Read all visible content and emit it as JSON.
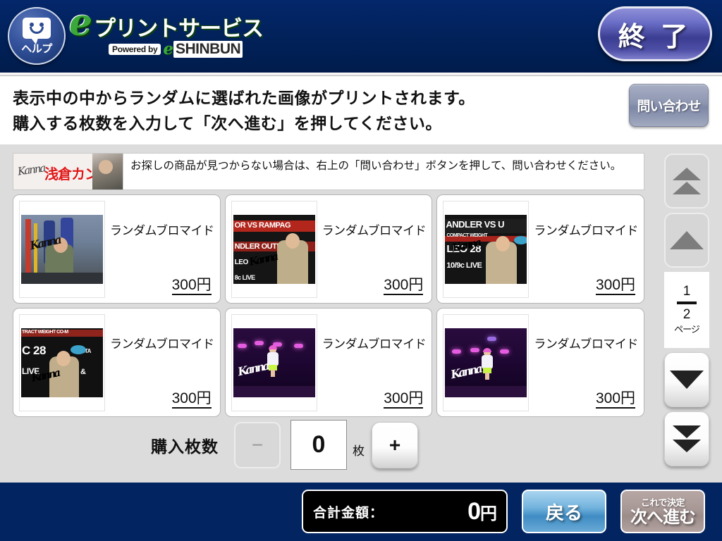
{
  "header": {
    "help_label": "ヘルプ",
    "logo_e": "e",
    "logo_jp": "プリントサービス",
    "powered_by": "Powered by",
    "shinbun_e": "e",
    "shinbun": "SHINBUN",
    "exit_label": "終 了",
    "bg_color": "#012159"
  },
  "instruction": {
    "line1": "表示中の中からランダムに選ばれた画像がプリントされます。",
    "line2": "購入する枚数を入力して「次へ進む」を押してください。",
    "inquiry_label": "問い合わせ"
  },
  "notice": {
    "thumb_signature": "Kanna",
    "thumb_name": "浅倉カンナ",
    "text": "お探しの商品が見つからない場合は、右上の「問い合わせ」ボタンを押して、問い合わせください。"
  },
  "products": [
    {
      "title": "ランダムブロマイド",
      "price": "300円",
      "photo": "gym-punching-bags",
      "signature": "Kanna"
    },
    {
      "title": "ランダムブロマイド",
      "price": "300円",
      "photo": "press-conference-backdrop-rampage",
      "signature": "Kanna"
    },
    {
      "title": "ランダムブロマイド",
      "price": "300円",
      "photo": "press-conference-microphone-chandler",
      "signature": "Kanna"
    },
    {
      "title": "ランダムブロマイド",
      "price": "300円",
      "photo": "press-conference-dec28-saitama",
      "signature": "Kanna"
    },
    {
      "title": "ランダムブロマイド",
      "price": "300円",
      "photo": "stage-performance-purple-lights",
      "signature": "Kanna"
    },
    {
      "title": "ランダムブロマイド",
      "price": "300円",
      "photo": "stage-performance-purple-lights-2",
      "signature": "Kanna"
    }
  ],
  "pager": {
    "first_page_label": "▲▲",
    "prev_page_label": "▲",
    "current_page": "1",
    "total_pages": "2",
    "page_unit": "ページ",
    "next_page_label": "▼",
    "last_page_label": "▼▼"
  },
  "quantity": {
    "label": "購入枚数",
    "minus_label": "−",
    "value": "0",
    "unit": "枚",
    "plus_label": "+"
  },
  "footer": {
    "total_label": "合計金額：",
    "total_value": "0",
    "total_currency": "円",
    "back_label": "戻る",
    "next_top_label": "これで決定",
    "next_main_label": "次へ進む",
    "bg_color": "#022460"
  }
}
